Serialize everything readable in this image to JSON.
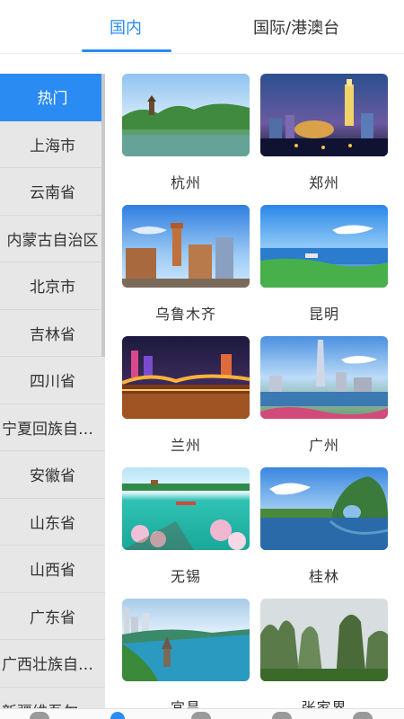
{
  "tabs": [
    {
      "label": "国内",
      "active": true
    },
    {
      "label": "国际/港澳台",
      "active": false
    }
  ],
  "sidebar": {
    "items": [
      {
        "label": "热门",
        "active": true
      },
      {
        "label": "上海市"
      },
      {
        "label": "云南省"
      },
      {
        "label": "内蒙古自治区"
      },
      {
        "label": "北京市"
      },
      {
        "label": "吉林省"
      },
      {
        "label": "四川省"
      },
      {
        "label": "宁夏回族自…"
      },
      {
        "label": "安徽省"
      },
      {
        "label": "山东省"
      },
      {
        "label": "山西省"
      },
      {
        "label": "广东省"
      },
      {
        "label": "广西壮族自…"
      },
      {
        "label": "新疆维吾尔…"
      }
    ]
  },
  "cities": [
    {
      "name": "杭州",
      "scene": "lake-pagoda"
    },
    {
      "name": "郑州",
      "scene": "city-night-tower"
    },
    {
      "name": "乌鲁木齐",
      "scene": "city-tower-day"
    },
    {
      "name": "昆明",
      "scene": "lake-coast"
    },
    {
      "name": "兰州",
      "scene": "bridge-night"
    },
    {
      "name": "广州",
      "scene": "canton-tower"
    },
    {
      "name": "无锡",
      "scene": "blossom-lake"
    },
    {
      "name": "桂林",
      "scene": "elephant-hill"
    },
    {
      "name": "宜昌",
      "scene": "riverside-pagoda"
    },
    {
      "name": "张家界",
      "scene": "karst-peaks"
    }
  ],
  "colors": {
    "accent": "#2a8bf2",
    "sidebar_bg": "#e7e7e7"
  }
}
